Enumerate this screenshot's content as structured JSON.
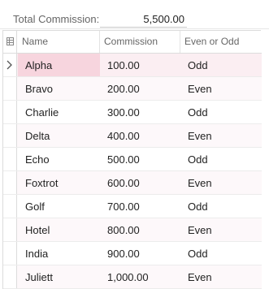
{
  "summary": {
    "label": "Total Commission:",
    "value": "5,500.00"
  },
  "columns": {
    "name": "Name",
    "commission": "Commission",
    "even_odd": "Even or Odd"
  },
  "rows": [
    {
      "name": "Alpha",
      "commission": "100.00",
      "even_odd": "Odd"
    },
    {
      "name": "Bravo",
      "commission": "200.00",
      "even_odd": "Even"
    },
    {
      "name": "Charlie",
      "commission": "300.00",
      "even_odd": "Odd"
    },
    {
      "name": "Delta",
      "commission": "400.00",
      "even_odd": "Even"
    },
    {
      "name": "Echo",
      "commission": "500.00",
      "even_odd": "Odd"
    },
    {
      "name": "Foxtrot",
      "commission": "600.00",
      "even_odd": "Even"
    },
    {
      "name": "Golf",
      "commission": "700.00",
      "even_odd": "Odd"
    },
    {
      "name": "Hotel",
      "commission": "800.00",
      "even_odd": "Even"
    },
    {
      "name": "India",
      "commission": "900.00",
      "even_odd": "Odd"
    },
    {
      "name": "Juliett",
      "commission": "1,000.00",
      "even_odd": "Even"
    }
  ],
  "icons": {
    "select_all": "grid-icon",
    "current_row": "chevron-right-icon"
  },
  "colors": {
    "selected_row": "#fbeef2",
    "selected_cell": "#f7d5de",
    "alt_row": "#fdf8fa"
  }
}
